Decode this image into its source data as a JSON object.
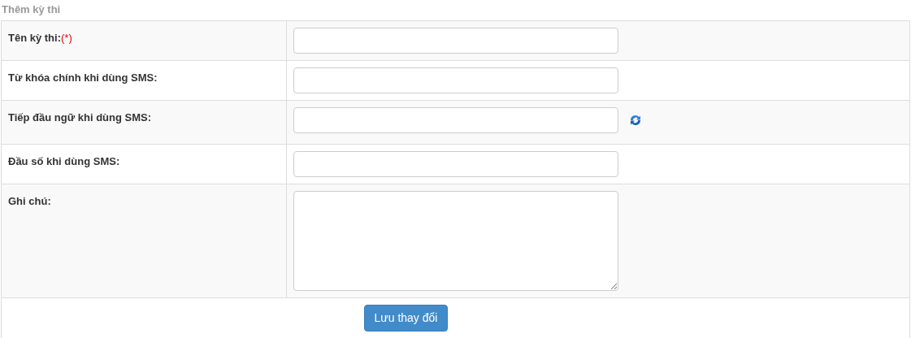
{
  "title": "Thêm kỳ thi",
  "rows": [
    {
      "label": "Tên kỳ thi:",
      "required_mark": "(*)",
      "kind": "input",
      "refresh": false
    },
    {
      "label": "Từ khóa chính khi dùng SMS:",
      "kind": "input",
      "refresh": false
    },
    {
      "label": "Tiếp đầu ngữ khi dùng SMS:",
      "kind": "input",
      "refresh": true
    },
    {
      "label": "Đầu số khi dùng SMS:",
      "kind": "input",
      "refresh": false
    },
    {
      "label": "Ghi chú:",
      "kind": "textarea",
      "refresh": false
    }
  ],
  "submit_button": "Lưu thay đổi"
}
